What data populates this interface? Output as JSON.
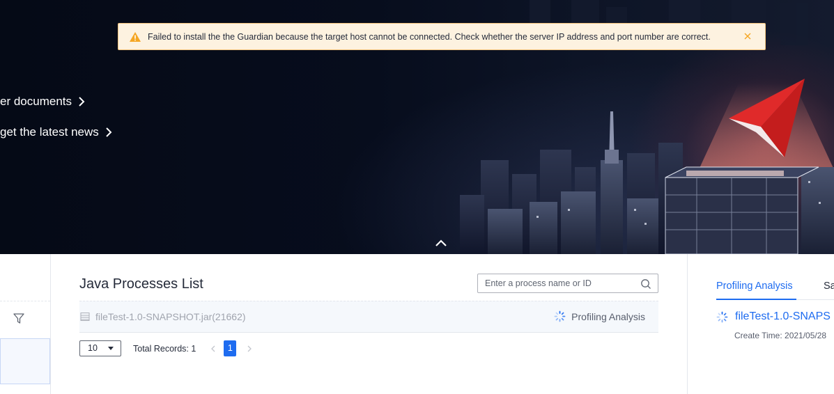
{
  "banner": {
    "link_documents": "er documents",
    "link_news": "get the latest news"
  },
  "alert": {
    "message": "Failed to install the the Guardian because the target host cannot be connected. Check whether the server IP address and port number are correct."
  },
  "process_list": {
    "title": "Java Processes List",
    "search_placeholder": "Enter a process name or ID",
    "rows": [
      {
        "name": "fileTest-1.0-SNAPSHOT.jar(21662)",
        "status": "Profiling Analysis"
      }
    ],
    "pagination": {
      "page_size": "10",
      "total_records": "Total Records: 1",
      "current_page": "1"
    }
  },
  "right_panel": {
    "tabs": [
      {
        "label": "Profiling Analysis",
        "active": true
      },
      {
        "label": "Sa",
        "active": false
      }
    ],
    "task": {
      "name": "fileTest-1.0-SNAPS",
      "create_time": "Create Time: 2021/05/28"
    }
  },
  "colors": {
    "accent": "#1e6cf0",
    "alert_bg": "#fdf2e0",
    "alert_border": "#f3c27a",
    "warning": "#f5a623"
  }
}
